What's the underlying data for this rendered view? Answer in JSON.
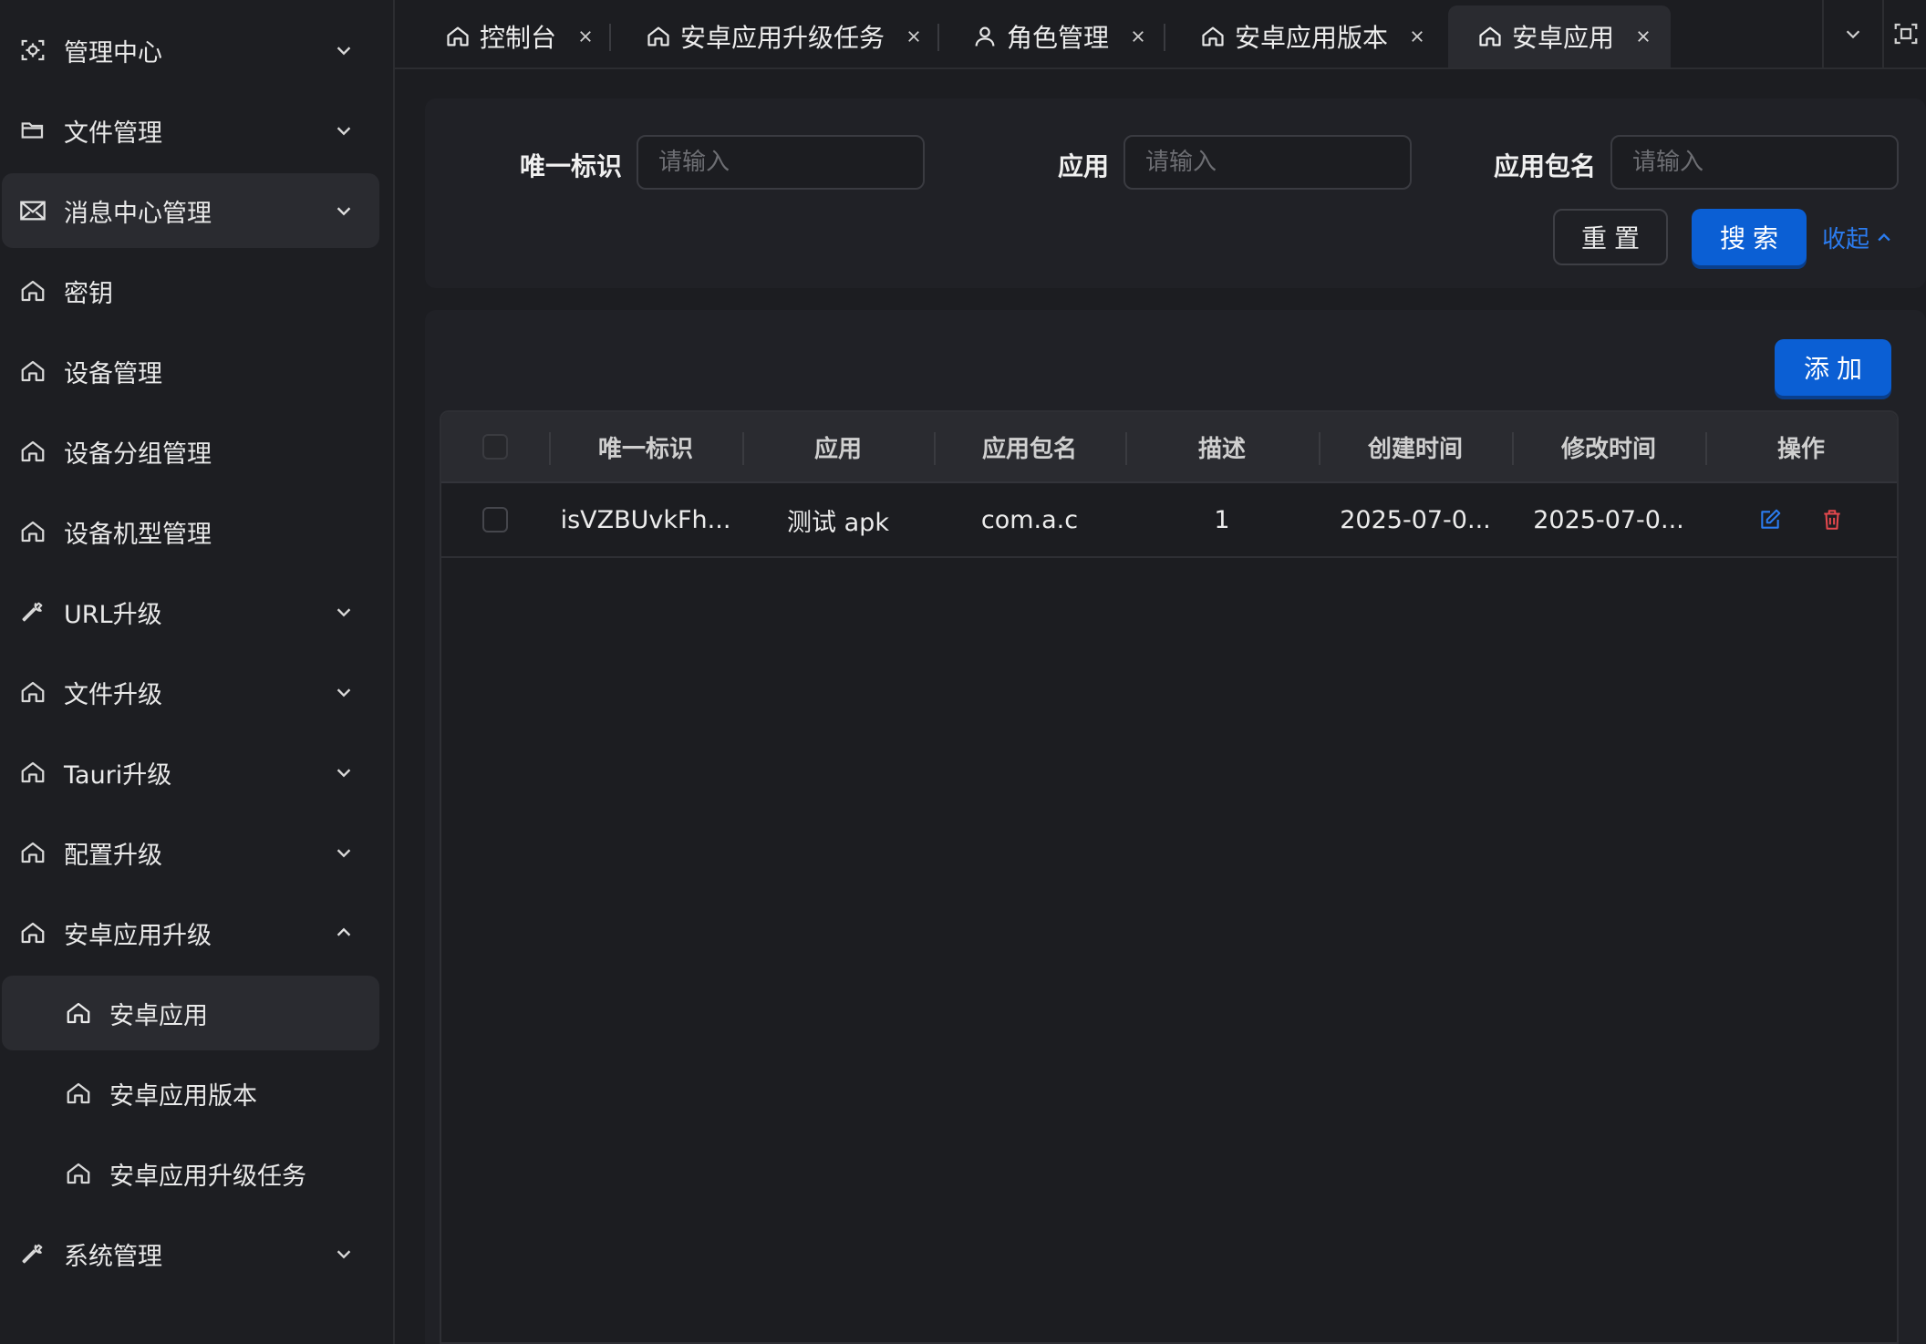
{
  "sidebar": {
    "items": [
      {
        "label": "管理中心",
        "icon": "scan-icon"
      },
      {
        "label": "文件管理",
        "icon": "folder-icon"
      },
      {
        "label": "消息中心管理",
        "icon": "mail-icon"
      },
      {
        "label": "密钥",
        "icon": "home-icon"
      },
      {
        "label": "设备管理",
        "icon": "home-icon"
      },
      {
        "label": "设备分组管理",
        "icon": "home-icon"
      },
      {
        "label": "设备机型管理",
        "icon": "home-icon"
      },
      {
        "label": "URL升级",
        "icon": "wrench-icon"
      },
      {
        "label": "文件升级",
        "icon": "home-icon"
      },
      {
        "label": "Tauri升级",
        "icon": "home-icon"
      },
      {
        "label": "配置升级",
        "icon": "home-icon"
      },
      {
        "label": "安卓应用升级",
        "icon": "home-icon"
      },
      {
        "label": "安卓应用",
        "icon": "home-icon"
      },
      {
        "label": "安卓应用版本",
        "icon": "home-icon"
      },
      {
        "label": "安卓应用升级任务",
        "icon": "home-icon"
      },
      {
        "label": "系统管理",
        "icon": "wrench-icon"
      }
    ]
  },
  "tabs": [
    {
      "label": "控制台",
      "icon": "home-icon"
    },
    {
      "label": "安卓应用升级任务",
      "icon": "home-icon"
    },
    {
      "label": "角色管理",
      "icon": "user-icon"
    },
    {
      "label": "安卓应用版本",
      "icon": "home-icon"
    },
    {
      "label": "安卓应用",
      "icon": "home-icon",
      "active": true
    }
  ],
  "search": {
    "fields": [
      {
        "label": "唯一标识",
        "placeholder": "请输入",
        "value": ""
      },
      {
        "label": "应用",
        "placeholder": "请输入",
        "value": ""
      },
      {
        "label": "应用包名",
        "placeholder": "请输入",
        "value": ""
      }
    ],
    "reset_label": "重置",
    "search_label": "搜索",
    "collapse_label": "收起"
  },
  "table": {
    "add_label": "添加",
    "columns": [
      "唯一标识",
      "应用",
      "应用包名",
      "描述",
      "创建时间",
      "修改时间",
      "操作"
    ],
    "rows": [
      {
        "uid": "isVZBUvkFh...",
        "app": "测试 apk",
        "package": "com.a.c",
        "desc": "1",
        "created": "2025-07-0...",
        "modified": "2025-07-0..."
      }
    ]
  },
  "colors": {
    "background": "#1c1d21",
    "panel": "#202126",
    "primary": "#0b5fd4",
    "link": "#2b7cf0",
    "danger": "#e5484d"
  }
}
